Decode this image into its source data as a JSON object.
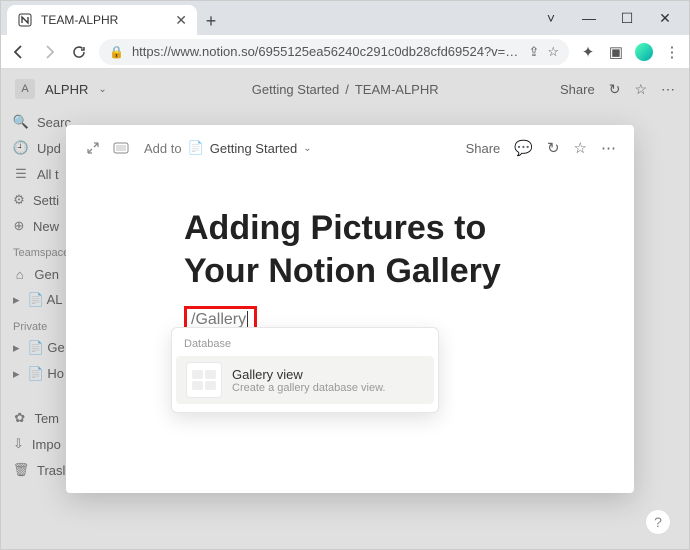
{
  "browser": {
    "tab_title": "TEAM-ALPHR",
    "url": "https://www.notion.so/6955125ea56240c291c0db28cfd69524?v=44f92629c3..."
  },
  "window_controls": {
    "chevron": "˅",
    "minimize": "—",
    "maximize": "☐",
    "close": "✕"
  },
  "workspace": {
    "initial": "A",
    "name": "ALPHR"
  },
  "breadcrumbs": {
    "parent": "Getting Started",
    "sep": "/",
    "current": "TEAM-ALPHR"
  },
  "topbar_actions": {
    "share": "Share",
    "clock": "↻",
    "star": "☆",
    "more": "⋯"
  },
  "sidebar": {
    "items_top": [
      {
        "icon": "🔍",
        "label": "Search"
      },
      {
        "icon": "🕘",
        "label": "Upd"
      },
      {
        "icon": "☰",
        "label": "All t"
      },
      {
        "icon": "⚙",
        "label": "Setti"
      },
      {
        "icon": "⊕",
        "label": "New"
      }
    ],
    "section1": "Teamspace",
    "items_team": [
      {
        "icon": "⌂",
        "label": "Gen"
      },
      {
        "icon": "▸",
        "label": "📄 AL"
      }
    ],
    "section2": "Private",
    "items_private": [
      {
        "icon": "▸",
        "label": "📄 Ge"
      },
      {
        "icon": "▸",
        "label": "📄 Ho"
      }
    ],
    "items_bottom": [
      {
        "icon": "✿",
        "label": "Tem"
      },
      {
        "icon": "⇩",
        "label": "Impo"
      },
      {
        "icon": "🗑",
        "label": "Trasl"
      }
    ]
  },
  "modal": {
    "addto_label": "Add to",
    "addto_page": "Getting Started",
    "share": "Share",
    "comment": "💬",
    "clock": "↻",
    "star": "☆",
    "more": "⋯"
  },
  "page": {
    "title_line1": "Adding Pictures to",
    "title_line2": "Your Notion Gallery",
    "slash_text": "/Gallery"
  },
  "popup": {
    "section": "Database",
    "item_title": "Gallery view",
    "item_sub": "Create a gallery database view."
  },
  "help": "?"
}
